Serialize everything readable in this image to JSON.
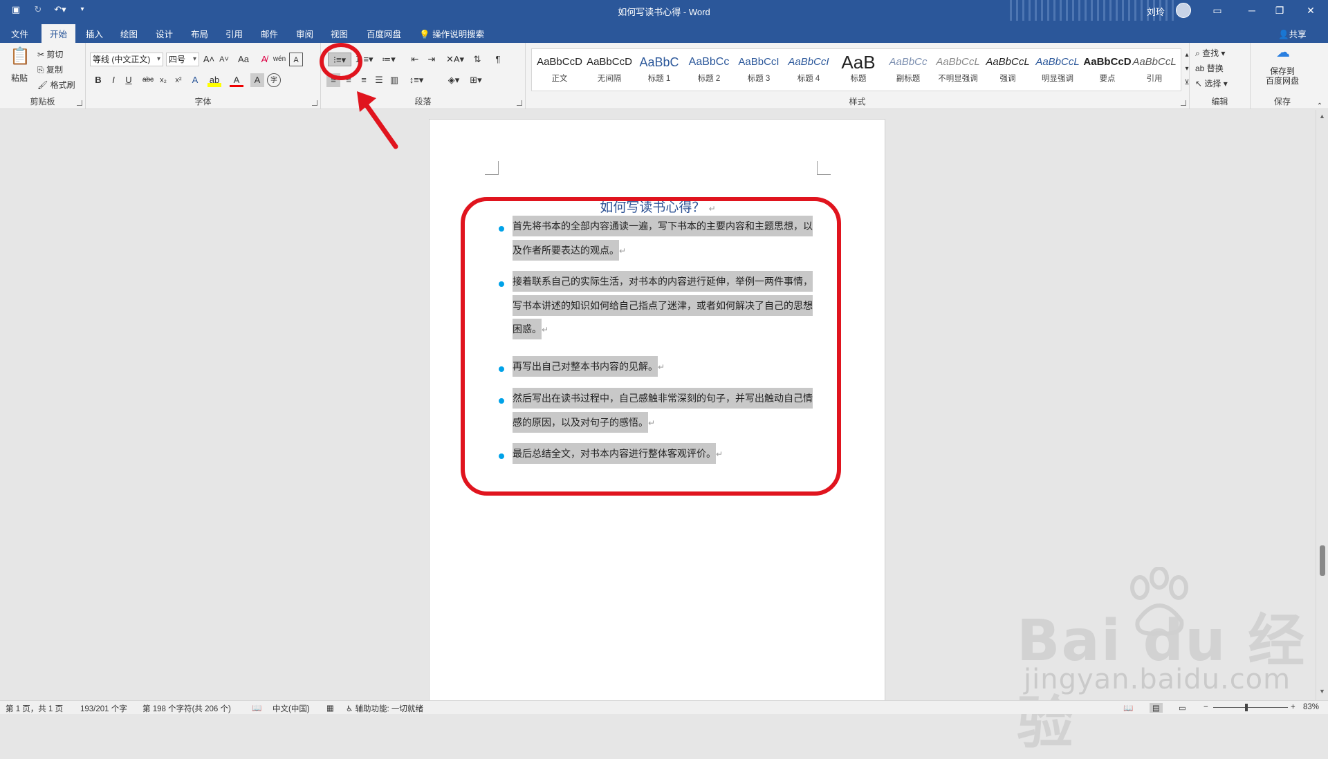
{
  "titlebar": {
    "title": "如何写读书心得 - Word",
    "user": "刘玲",
    "qat": [
      "save-icon",
      "refresh-icon",
      "undo-icon",
      "customize-icon"
    ]
  },
  "tabs": [
    {
      "label": "文件",
      "active": false
    },
    {
      "label": "开始",
      "active": true
    },
    {
      "label": "插入",
      "active": false
    },
    {
      "label": "绘图",
      "active": false
    },
    {
      "label": "设计",
      "active": false
    },
    {
      "label": "布局",
      "active": false
    },
    {
      "label": "引用",
      "active": false
    },
    {
      "label": "邮件",
      "active": false
    },
    {
      "label": "审阅",
      "active": false
    },
    {
      "label": "视图",
      "active": false
    },
    {
      "label": "百度网盘",
      "active": false
    }
  ],
  "tellme": "操作说明搜索",
  "share": "共享",
  "clipboard": {
    "paste": "粘贴",
    "cut": "剪切",
    "copy": "复制",
    "format_painter": "格式刷",
    "label": "剪贴板"
  },
  "font": {
    "name": "等线 (中文正文)",
    "size": "四号",
    "label": "字体"
  },
  "paragraph": {
    "label": "段落"
  },
  "styles": {
    "label": "样式",
    "items": [
      {
        "preview": "AaBbCcD",
        "name": "正文"
      },
      {
        "preview": "AaBbCcD",
        "name": "无间隔"
      },
      {
        "preview": "AaBbC",
        "name": "标题 1"
      },
      {
        "preview": "AaBbCc",
        "name": "标题 2"
      },
      {
        "preview": "AaBbCcI",
        "name": "标题 3"
      },
      {
        "preview": "AaBbCcI",
        "name": "标题 4"
      },
      {
        "preview": "AaB",
        "name": "标题"
      },
      {
        "preview": "AaBbCc",
        "name": "副标题"
      },
      {
        "preview": "AaBbCcL",
        "name": "不明显强调"
      },
      {
        "preview": "AaBbCcL",
        "name": "强调"
      },
      {
        "preview": "AaBbCcL",
        "name": "明显强调"
      },
      {
        "preview": "AaBbCcD",
        "name": "要点"
      },
      {
        "preview": "AaBbCcL",
        "name": "引用"
      }
    ]
  },
  "editing": {
    "find": "查找",
    "replace": "替换",
    "select": "选择",
    "label": "编辑"
  },
  "save": {
    "btn": "保存到\n百度网盘",
    "label": "保存"
  },
  "document": {
    "title": "如何写读书心得？",
    "items": [
      "首先将书本的全部内容通读一遍，写下书本的主要内容和主题思想，以及作者所要表达的观点。",
      "接着联系自己的实际生活，对书本的内容进行延伸，举例一两件事情，写书本讲述的知识如何给自己指点了迷津，或者如何解决了自己的思想困惑。",
      "再写出自己对整本书内容的见解。",
      "然后写出在读书过程中，自己感触非常深刻的句子，并写出触动自己情感的原因，以及对句子的感悟。",
      "最后总结全文，对书本内容进行整体客观评价。"
    ],
    "para_mark": "↵"
  },
  "status": {
    "page": "第 1 页，共 1 页",
    "words": "193/201 个字",
    "chars": "第 198 个字符(共 206 个)",
    "lang": "中文(中国)",
    "access": "辅助功能: 一切就绪",
    "zoom": "83%"
  },
  "watermark": {
    "big": "Bai du 经验",
    "small": "jingyan.baidu.com"
  },
  "colors": {
    "brand": "#2b579a",
    "highlight": "#e0141e",
    "bullet": "#00a2e8"
  }
}
